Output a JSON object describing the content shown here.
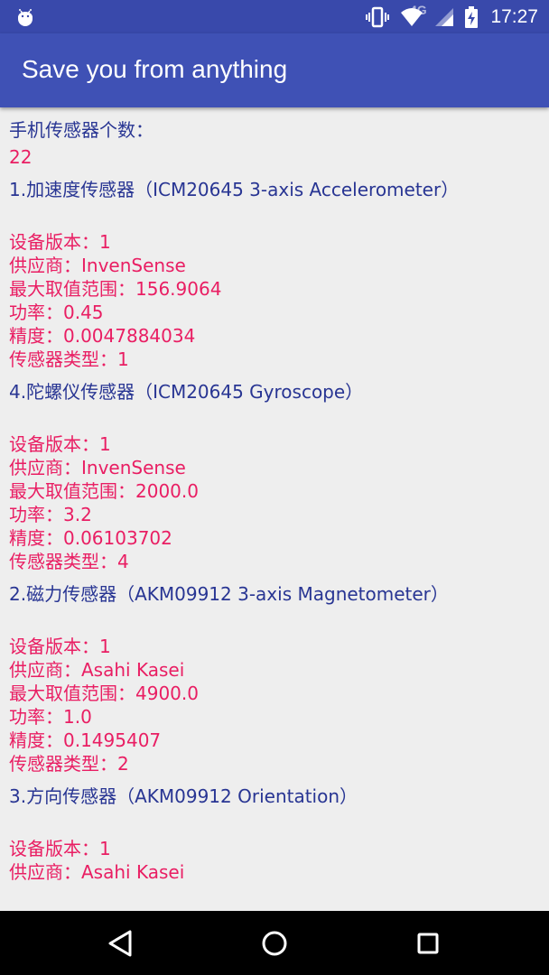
{
  "status": {
    "time": "17:27",
    "network_type": "4G"
  },
  "app": {
    "title": "Save you from anything"
  },
  "count": {
    "label": "手机传感器个数：",
    "value": "22"
  },
  "sensors": [
    {
      "title": "1.加速度传感器（ICM20645 3-axis Accelerometer）",
      "version": "设备版本：1",
      "vendor": "供应商：InvenSense",
      "max_range": "最大取值范围：156.9064",
      "power": "功率：0.45",
      "resolution": "精度：0.0047884034",
      "type": "传感器类型：1"
    },
    {
      "title": "4.陀螺仪传感器（ICM20645 Gyroscope）",
      "version": "设备版本：1",
      "vendor": "供应商：InvenSense",
      "max_range": "最大取值范围：2000.0",
      "power": "功率：3.2",
      "resolution": "精度：0.06103702",
      "type": "传感器类型：4"
    },
    {
      "title": "2.磁力传感器（AKM09912 3-axis Magnetometer）",
      "version": "设备版本：1",
      "vendor": "供应商：Asahi Kasei",
      "max_range": "最大取值范围：4900.0",
      "power": "功率：1.0",
      "resolution": "精度：0.1495407",
      "type": "传感器类型：2"
    },
    {
      "title": "3.方向传感器（AKM09912 Orientation）",
      "version": "设备版本：1",
      "vendor": "供应商：Asahi Kasei"
    }
  ],
  "colors": {
    "status_bar": "#3949ab",
    "app_bar": "#3f51b5",
    "background": "#eeeeee",
    "title_text": "#283593",
    "value_text": "#e91e63",
    "nav_bar": "#000000"
  },
  "icons": {
    "status_left": "android-debug-icon",
    "vibrate": "vibrate-icon",
    "wifi": "wifi-icon",
    "signal": "cell-signal-icon",
    "battery": "battery-charging-icon",
    "nav_back": "back-triangle-icon",
    "nav_home": "home-circle-icon",
    "nav_recents": "recents-square-icon"
  }
}
